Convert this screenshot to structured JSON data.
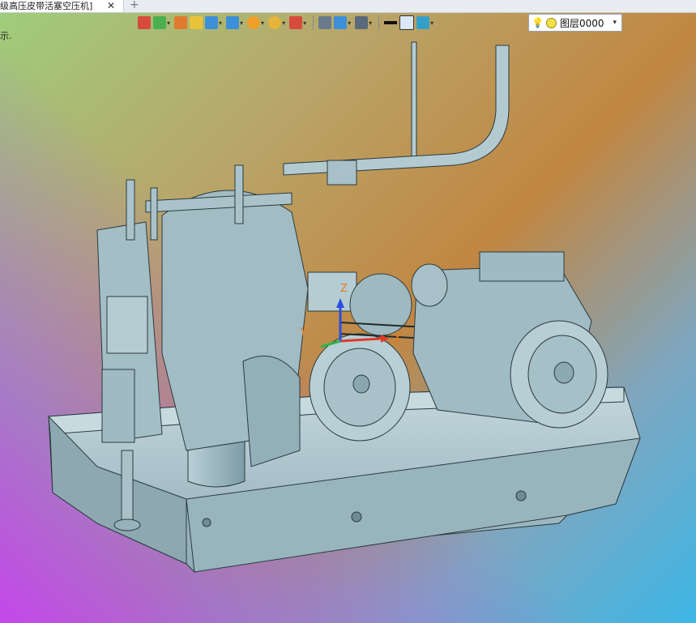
{
  "tab": {
    "title": "级高压皮带活塞空压机]",
    "close_glyph": "✕",
    "add_glyph": "+"
  },
  "viewport": {
    "hint_text": "示."
  },
  "toolbar": {
    "buttons": [
      {
        "icon": "exit-icon",
        "color": "#d64b3c",
        "dropdown": false
      },
      {
        "icon": "paint-bucket-icon",
        "color": "#4caf50",
        "dropdown": true
      },
      {
        "icon": "pen-icon",
        "color": "#e07a2f",
        "dropdown": false
      },
      {
        "icon": "cube-yellow-icon",
        "color": "#e8c33a",
        "dropdown": false
      },
      {
        "icon": "cube-blue-icon",
        "color": "#3d8fd8",
        "dropdown": true
      },
      {
        "icon": "shaded-cube-icon",
        "color": "#3d8fd8",
        "dropdown": true
      },
      {
        "icon": "sun-icon",
        "color": "#f0a02a",
        "dropdown": true
      },
      {
        "icon": "magnifier-icon",
        "color": "#e4b53a",
        "dropdown": true
      },
      {
        "icon": "axis-icon",
        "color": "#d64b3c",
        "dropdown": true
      },
      {
        "icon": "frame-icon",
        "color": "#6a7a8a",
        "dropdown": false
      },
      {
        "icon": "ruler-icon",
        "color": "#3d8fd8",
        "dropdown": true
      },
      {
        "icon": "monitor-icon",
        "color": "#5a6a7a",
        "dropdown": true
      },
      {
        "icon": "line-weight-icon",
        "color": "#111111",
        "dropdown": false
      },
      {
        "icon": "color-box-icon",
        "color": "#dbe7f3",
        "dropdown": false
      },
      {
        "icon": "layers-icon",
        "color": "#34a0c8",
        "dropdown": true
      }
    ],
    "layer_select": {
      "bulb_glyph": "💡",
      "value": "图层0000",
      "arrow_glyph": "▾"
    }
  },
  "axes": {
    "x_label": "X",
    "y_label": "Y",
    "z_label": "Z"
  },
  "colors": {
    "model_fill": "#a9c4cc",
    "model_stroke": "#2a3a40"
  }
}
